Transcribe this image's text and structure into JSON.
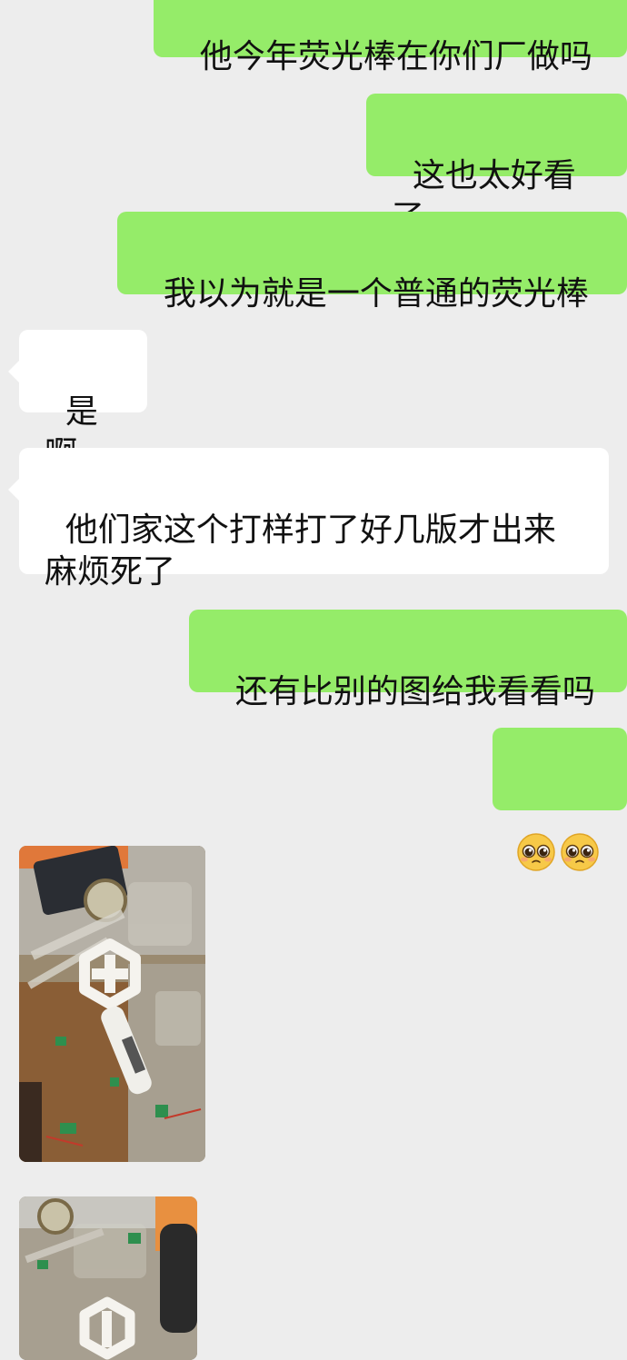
{
  "messages": [
    {
      "side": "out",
      "text": "他今年荧光棒在你们厂做吗"
    },
    {
      "side": "out",
      "text": "这也太好看了"
    },
    {
      "side": "out",
      "text": "我以为就是一个普通的荧光棒"
    },
    {
      "side": "in",
      "text": "是啊"
    },
    {
      "side": "in",
      "text": "他们家这个打样打了好几版才出来\n麻烦死了"
    },
    {
      "side": "out",
      "text": "还有比别的图给我看看吗"
    },
    {
      "side": "out",
      "emoji": [
        "pleading-face-icon",
        "pleading-face-icon"
      ]
    },
    {
      "side": "in",
      "image": "workbench-photo-lightstick-prototype"
    },
    {
      "side": "in",
      "image": "workbench-photo-lightstick-parts"
    }
  ],
  "colors": {
    "background": "#ededed",
    "outgoing_bubble": "#95ec69",
    "incoming_bubble": "#ffffff"
  }
}
